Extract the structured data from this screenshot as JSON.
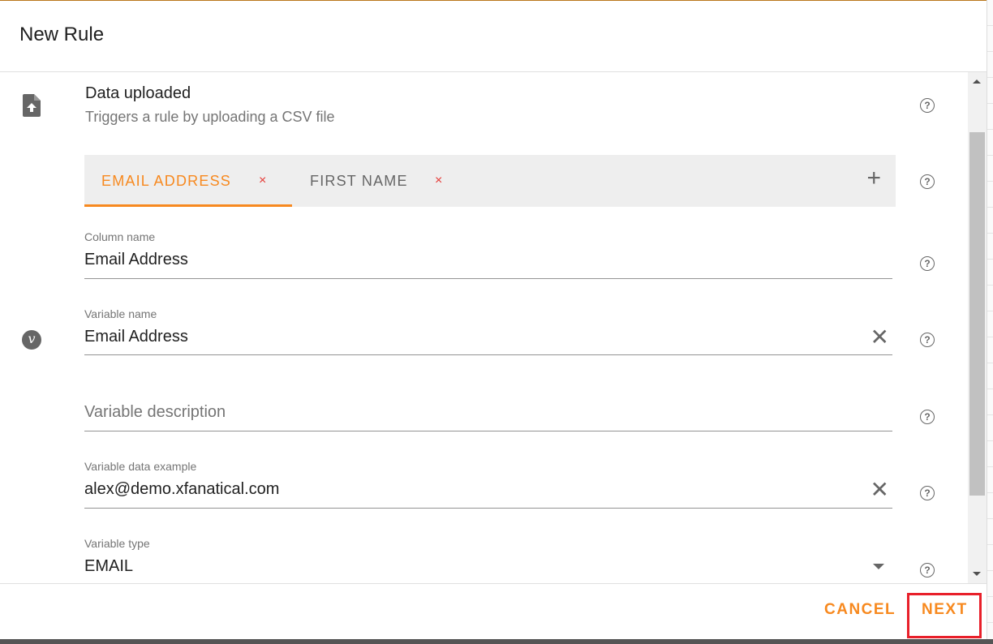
{
  "dialog": {
    "title": "New Rule"
  },
  "trigger": {
    "title": "Data uploaded",
    "subtitle": "Triggers a rule by uploading a CSV file",
    "icon": "file-upload-icon"
  },
  "tabs": [
    {
      "label": "EMAIL ADDRESS",
      "active": true,
      "remove": "×"
    },
    {
      "label": "FIRST NAME",
      "active": false,
      "remove": "×"
    }
  ],
  "add_tab": "+",
  "fields": {
    "column_name": {
      "label": "Column name",
      "value": "Email Address"
    },
    "variable_name": {
      "label": "Variable name",
      "value": "Email Address"
    },
    "variable_description": {
      "placeholder": "Variable description",
      "value": ""
    },
    "variable_example": {
      "label": "Variable data example",
      "value": "alex@demo.xfanatical.com"
    },
    "variable_type": {
      "label": "Variable type",
      "value": "EMAIL"
    }
  },
  "help_glyph": "?",
  "clear_glyph": "✕",
  "variable_icon": "v",
  "footer": {
    "cancel": "CANCEL",
    "next": "NEXT"
  },
  "colors": {
    "accent": "#f7891f",
    "highlight": "#e8202a",
    "remove": "#e53935"
  }
}
